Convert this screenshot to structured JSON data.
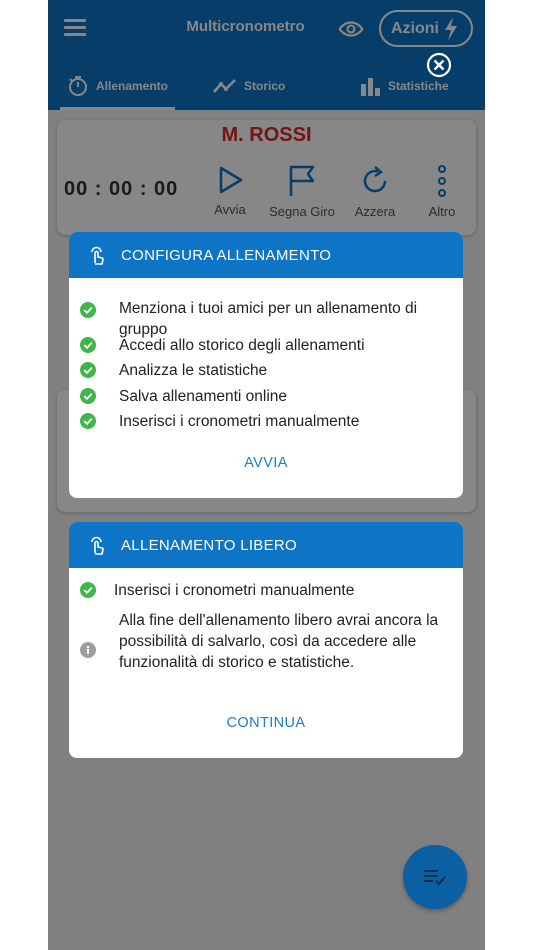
{
  "appbar": {
    "title": "Multicronometro",
    "actions_label": "Azioni"
  },
  "tabs": [
    {
      "label": "Allenamento",
      "icon": "stopwatch-icon",
      "selected": true
    },
    {
      "label": "Storico",
      "icon": "trend-icon",
      "selected": false
    },
    {
      "label": "Statistiche",
      "icon": "bar-chart-icon",
      "selected": false
    }
  ],
  "athlete_card": {
    "name": "M. ROSSI",
    "timer": "00 : 00 : 00",
    "controls": [
      {
        "label": "Avvia",
        "icon": "play-icon"
      },
      {
        "label": "Segna Giro",
        "icon": "flag-icon"
      },
      {
        "label": "Azzera",
        "icon": "refresh-icon"
      },
      {
        "label": "Altro",
        "icon": "more-vert-icon"
      }
    ]
  },
  "dialog_configure": {
    "title": "CONFIGURA ALLENAMENTO",
    "features": [
      "Menziona i tuoi amici per un allenamento di gruppo",
      "Accedi allo storico degli allenamenti",
      "Analizza le statistiche",
      "Salva allenamenti online",
      "Inserisci i cronometri manualmente"
    ],
    "action": "AVVIA"
  },
  "dialog_free": {
    "title": "ALLENAMENTO LIBERO",
    "feature": "Inserisci i cronometri manualmente",
    "info": "Alla fine dell'allenamento libero avrai ancora la possibilità di salvarlo, così da accedere alle funzionalità di storico e statistiche.",
    "action": "CONTINUA"
  },
  "colors": {
    "primary": "#0d74c6",
    "check": "#3fb54a",
    "accent_text": "#1a7fc6",
    "name_red": "#d62828"
  }
}
